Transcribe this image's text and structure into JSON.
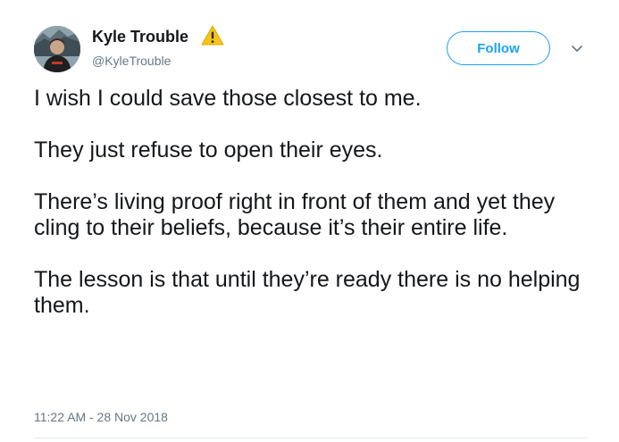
{
  "author": {
    "display_name": "Kyle Trouble",
    "username": "@KyleTrouble",
    "badge_icon": "warning-icon"
  },
  "actions": {
    "follow_label": "Follow",
    "menu_icon": "chevron-down-icon"
  },
  "tweet": {
    "paragraphs": [
      "I wish I could save those closest to me.",
      "They just refuse to open their eyes.",
      "There’s living proof right in front of them and yet they cling to their beliefs, because it’s their entire life.",
      "The lesson is that until they’re ready there is no helping them."
    ],
    "timestamp": "11:22 AM - 28 Nov 2018"
  },
  "colors": {
    "accent": "#1da1f2",
    "text": "#14171a",
    "muted": "#657786",
    "warning": "#f5c518"
  }
}
